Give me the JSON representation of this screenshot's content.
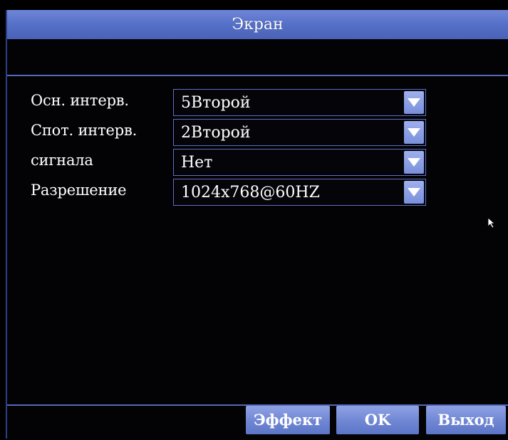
{
  "window": {
    "title": "Экран"
  },
  "settings": [
    {
      "label": "Осн. интерв.",
      "value": "5Второй"
    },
    {
      "label": "Спот. интерв.",
      "value": "2Второй"
    },
    {
      "label": "сигнала",
      "value": "Нет"
    },
    {
      "label": "Разрешение",
      "value": "1024x768@60HZ"
    }
  ],
  "buttons": {
    "effect": "Эффект",
    "ok": "OK",
    "exit": "Выход"
  },
  "icons": {
    "dropdown": "chevron-down-icon",
    "cursor": "mouse-pointer-icon"
  },
  "colors": {
    "title_bar": "#5570c8",
    "button": "#6f86d3",
    "border": "#5d6fc2",
    "background": "#000000"
  }
}
